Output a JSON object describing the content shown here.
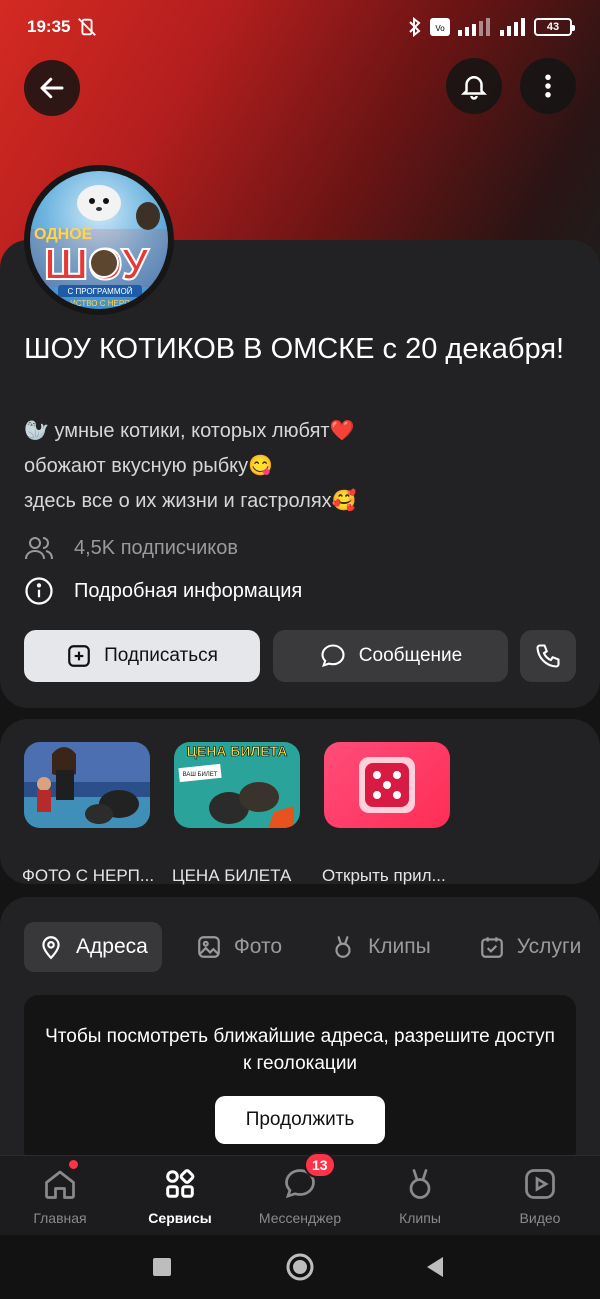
{
  "status_bar": {
    "time": "19:35",
    "battery": "43"
  },
  "profile": {
    "title": "ШОУ КОТИКОВ В ОМСКЕ с 20 декабря!",
    "description_lines": [
      "🦭 умные котики, которых любят❤️",
      "обожают вкусную рыбку😋",
      "здесь все о их жизни и гастролях🥰"
    ],
    "subscribers": "4,5K подписчиков",
    "more_info": "Подробная информация",
    "subscribe_label": "Подписаться",
    "message_label": "Сообщение",
    "avatar_text": {
      "top": "ОДНОЕ",
      "main": "ШОУ",
      "sub1": "С ПРОГРАММОЙ",
      "sub2": "ИСТВО С НЕРП"
    }
  },
  "apps": [
    {
      "label": "ФОТО С НЕРП..."
    },
    {
      "label": "ЦЕНА БИЛЕТА",
      "thumb_title": "ЦЕНА БИЛЕТА",
      "thumb_tag": "ВАШ БИЛЕТ"
    },
    {
      "label": "Открыть прил..."
    }
  ],
  "tabs": [
    {
      "label": "Адреса",
      "icon": "location-pin-icon",
      "active": true
    },
    {
      "label": "Фото",
      "icon": "image-icon",
      "active": false
    },
    {
      "label": "Клипы",
      "icon": "clips-icon",
      "active": false
    },
    {
      "label": "Услуги",
      "icon": "calendar-check-icon",
      "active": false
    }
  ],
  "geo_prompt": {
    "text": "Чтобы посмотреть ближайшие адреса, разрешите доступ к геолокации",
    "button": "Продолжить"
  },
  "bottom_nav": [
    {
      "label": "Главная",
      "icon": "home-icon",
      "dot": true
    },
    {
      "label": "Сервисы",
      "icon": "services-icon",
      "active": true
    },
    {
      "label": "Мессенджер",
      "icon": "messenger-icon",
      "badge": "13"
    },
    {
      "label": "Клипы",
      "icon": "clips-icon"
    },
    {
      "label": "Видео",
      "icon": "video-icon"
    }
  ],
  "colors": {
    "accent_red": "#ff3347",
    "card_bg": "#222224",
    "page_bg": "#141414"
  }
}
